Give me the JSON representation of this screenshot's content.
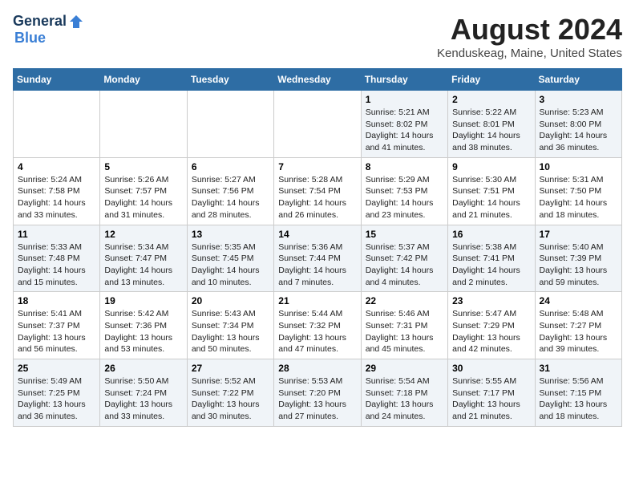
{
  "header": {
    "logo_general": "General",
    "logo_blue": "Blue",
    "month": "August 2024",
    "location": "Kenduskeag, Maine, United States"
  },
  "columns": [
    "Sunday",
    "Monday",
    "Tuesday",
    "Wednesday",
    "Thursday",
    "Friday",
    "Saturday"
  ],
  "weeks": [
    [
      {
        "day": "",
        "content": ""
      },
      {
        "day": "",
        "content": ""
      },
      {
        "day": "",
        "content": ""
      },
      {
        "day": "",
        "content": ""
      },
      {
        "day": "1",
        "content": "Sunrise: 5:21 AM\nSunset: 8:02 PM\nDaylight: 14 hours and 41 minutes."
      },
      {
        "day": "2",
        "content": "Sunrise: 5:22 AM\nSunset: 8:01 PM\nDaylight: 14 hours and 38 minutes."
      },
      {
        "day": "3",
        "content": "Sunrise: 5:23 AM\nSunset: 8:00 PM\nDaylight: 14 hours and 36 minutes."
      }
    ],
    [
      {
        "day": "4",
        "content": "Sunrise: 5:24 AM\nSunset: 7:58 PM\nDaylight: 14 hours and 33 minutes."
      },
      {
        "day": "5",
        "content": "Sunrise: 5:26 AM\nSunset: 7:57 PM\nDaylight: 14 hours and 31 minutes."
      },
      {
        "day": "6",
        "content": "Sunrise: 5:27 AM\nSunset: 7:56 PM\nDaylight: 14 hours and 28 minutes."
      },
      {
        "day": "7",
        "content": "Sunrise: 5:28 AM\nSunset: 7:54 PM\nDaylight: 14 hours and 26 minutes."
      },
      {
        "day": "8",
        "content": "Sunrise: 5:29 AM\nSunset: 7:53 PM\nDaylight: 14 hours and 23 minutes."
      },
      {
        "day": "9",
        "content": "Sunrise: 5:30 AM\nSunset: 7:51 PM\nDaylight: 14 hours and 21 minutes."
      },
      {
        "day": "10",
        "content": "Sunrise: 5:31 AM\nSunset: 7:50 PM\nDaylight: 14 hours and 18 minutes."
      }
    ],
    [
      {
        "day": "11",
        "content": "Sunrise: 5:33 AM\nSunset: 7:48 PM\nDaylight: 14 hours and 15 minutes."
      },
      {
        "day": "12",
        "content": "Sunrise: 5:34 AM\nSunset: 7:47 PM\nDaylight: 14 hours and 13 minutes."
      },
      {
        "day": "13",
        "content": "Sunrise: 5:35 AM\nSunset: 7:45 PM\nDaylight: 14 hours and 10 minutes."
      },
      {
        "day": "14",
        "content": "Sunrise: 5:36 AM\nSunset: 7:44 PM\nDaylight: 14 hours and 7 minutes."
      },
      {
        "day": "15",
        "content": "Sunrise: 5:37 AM\nSunset: 7:42 PM\nDaylight: 14 hours and 4 minutes."
      },
      {
        "day": "16",
        "content": "Sunrise: 5:38 AM\nSunset: 7:41 PM\nDaylight: 14 hours and 2 minutes."
      },
      {
        "day": "17",
        "content": "Sunrise: 5:40 AM\nSunset: 7:39 PM\nDaylight: 13 hours and 59 minutes."
      }
    ],
    [
      {
        "day": "18",
        "content": "Sunrise: 5:41 AM\nSunset: 7:37 PM\nDaylight: 13 hours and 56 minutes."
      },
      {
        "day": "19",
        "content": "Sunrise: 5:42 AM\nSunset: 7:36 PM\nDaylight: 13 hours and 53 minutes."
      },
      {
        "day": "20",
        "content": "Sunrise: 5:43 AM\nSunset: 7:34 PM\nDaylight: 13 hours and 50 minutes."
      },
      {
        "day": "21",
        "content": "Sunrise: 5:44 AM\nSunset: 7:32 PM\nDaylight: 13 hours and 47 minutes."
      },
      {
        "day": "22",
        "content": "Sunrise: 5:46 AM\nSunset: 7:31 PM\nDaylight: 13 hours and 45 minutes."
      },
      {
        "day": "23",
        "content": "Sunrise: 5:47 AM\nSunset: 7:29 PM\nDaylight: 13 hours and 42 minutes."
      },
      {
        "day": "24",
        "content": "Sunrise: 5:48 AM\nSunset: 7:27 PM\nDaylight: 13 hours and 39 minutes."
      }
    ],
    [
      {
        "day": "25",
        "content": "Sunrise: 5:49 AM\nSunset: 7:25 PM\nDaylight: 13 hours and 36 minutes."
      },
      {
        "day": "26",
        "content": "Sunrise: 5:50 AM\nSunset: 7:24 PM\nDaylight: 13 hours and 33 minutes."
      },
      {
        "day": "27",
        "content": "Sunrise: 5:52 AM\nSunset: 7:22 PM\nDaylight: 13 hours and 30 minutes."
      },
      {
        "day": "28",
        "content": "Sunrise: 5:53 AM\nSunset: 7:20 PM\nDaylight: 13 hours and 27 minutes."
      },
      {
        "day": "29",
        "content": "Sunrise: 5:54 AM\nSunset: 7:18 PM\nDaylight: 13 hours and 24 minutes."
      },
      {
        "day": "30",
        "content": "Sunrise: 5:55 AM\nSunset: 7:17 PM\nDaylight: 13 hours and 21 minutes."
      },
      {
        "day": "31",
        "content": "Sunrise: 5:56 AM\nSunset: 7:15 PM\nDaylight: 13 hours and 18 minutes."
      }
    ]
  ]
}
